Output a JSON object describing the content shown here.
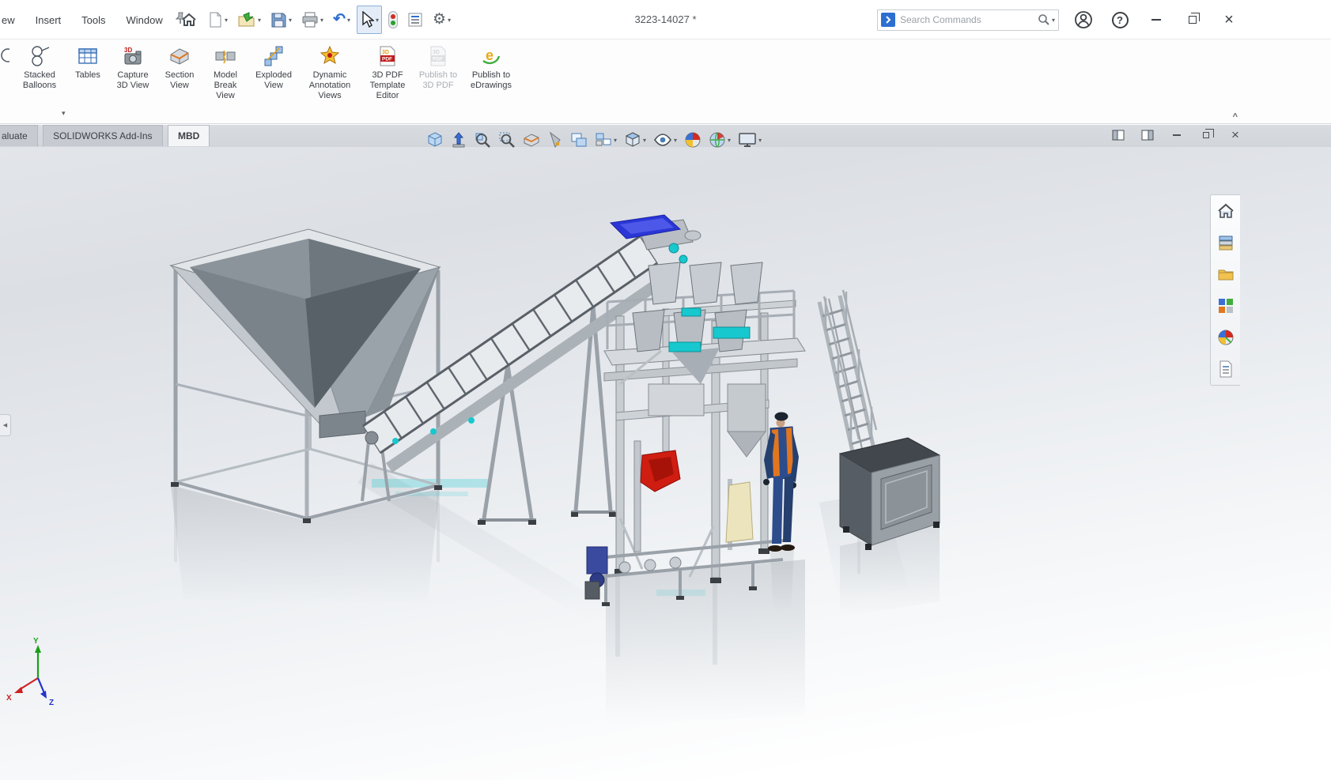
{
  "window": {
    "title": "3223-14027 *",
    "search": {
      "placeholder": "Search Commands"
    }
  },
  "icons": {
    "caret": "▾",
    "help_glyph": "?",
    "close_glyph": "×",
    "collapse_left_glyph": "◀",
    "ribbon_collapse_glyph": "^",
    "undo_glyph": "↶",
    "gear_glyph": "⚙",
    "badge_3d": "3D",
    "badge_pdf": "PDF",
    "edrawings_e": "e"
  },
  "menubar": {
    "items": [
      {
        "label": "ew"
      },
      {
        "label": "Insert"
      },
      {
        "label": "Tools"
      },
      {
        "label": "Window"
      }
    ]
  },
  "ribbon": {
    "buttons": [
      {
        "label": "Stacked Balloons"
      },
      {
        "label": "Tables"
      },
      {
        "label": "Capture 3D View"
      },
      {
        "label": "Section View"
      },
      {
        "label": "Model Break View"
      },
      {
        "label": "Exploded View"
      },
      {
        "label": "Dynamic Annotation Views"
      },
      {
        "label": "3D PDF Template Editor"
      },
      {
        "label": "Publish to 3D PDF"
      },
      {
        "label": "Publish to eDrawings"
      }
    ]
  },
  "tabs": [
    {
      "label": "aluate"
    },
    {
      "label": "SOLIDWORKS Add-Ins"
    },
    {
      "label": "MBD"
    }
  ],
  "viewport": {
    "triad": {
      "x": "X",
      "y": "Y",
      "z": "Z"
    }
  },
  "colors": {
    "accent_blue": "#2d6fd1",
    "teal_part": "#17c8ce",
    "tray_blue": "#2b36d6",
    "alert_red": "#d01d12"
  }
}
